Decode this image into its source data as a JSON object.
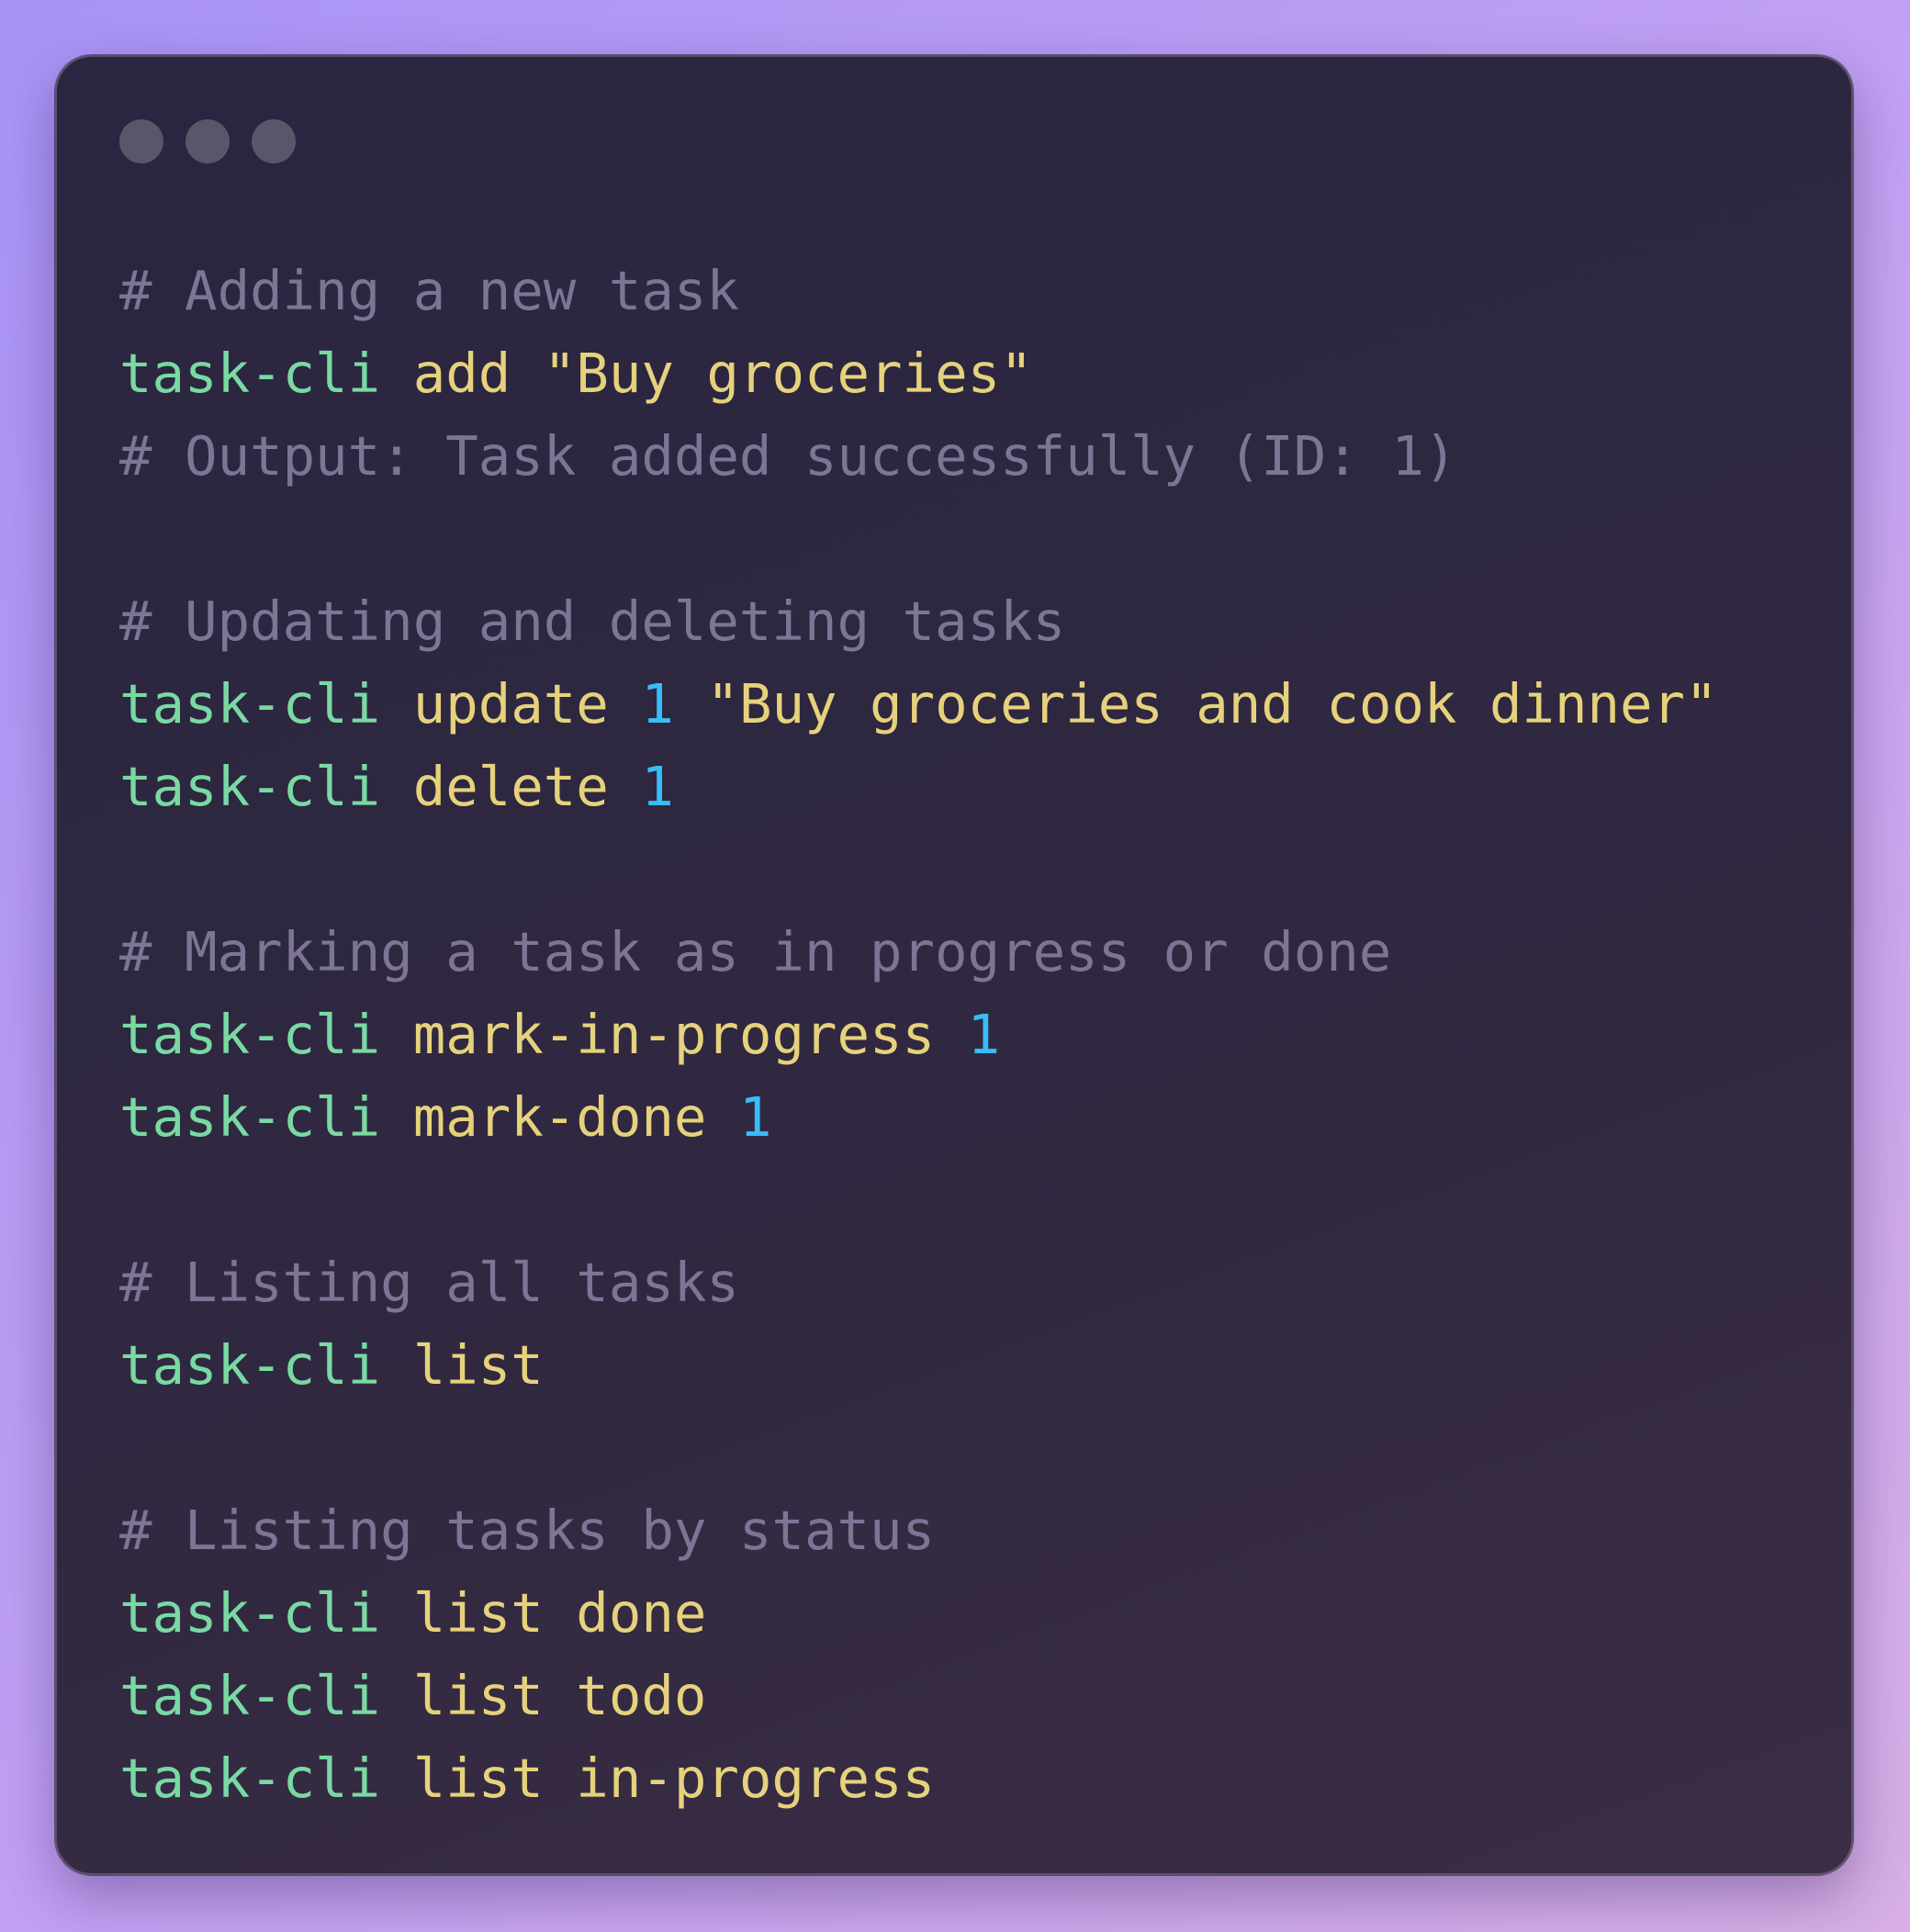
{
  "window": {
    "controls": [
      "close",
      "minimize",
      "maximize"
    ]
  },
  "colors": {
    "comment": "#7d7596",
    "command": "#79d9a3",
    "subcommand": "#e6d27c",
    "number": "#38bdf8",
    "string": "#e6d27c"
  },
  "code": {
    "lines": [
      {
        "kind": "comment",
        "text": "# Adding a new task"
      },
      {
        "kind": "code",
        "cmd": "task-cli",
        "sub": "add",
        "str": "\"Buy groceries\""
      },
      {
        "kind": "comment",
        "text": "# Output: Task added successfully (ID: 1)"
      },
      {
        "kind": "blank"
      },
      {
        "kind": "comment",
        "text": "# Updating and deleting tasks"
      },
      {
        "kind": "code",
        "cmd": "task-cli",
        "sub": "update",
        "num": "1",
        "str": "\"Buy groceries and cook dinner\""
      },
      {
        "kind": "code",
        "cmd": "task-cli",
        "sub": "delete",
        "num": "1"
      },
      {
        "kind": "blank"
      },
      {
        "kind": "comment",
        "text": "# Marking a task as in progress or done"
      },
      {
        "kind": "code",
        "cmd": "task-cli",
        "sub": "mark-in-progress",
        "num": "1"
      },
      {
        "kind": "code",
        "cmd": "task-cli",
        "sub": "mark-done",
        "num": "1"
      },
      {
        "kind": "blank"
      },
      {
        "kind": "comment",
        "text": "# Listing all tasks"
      },
      {
        "kind": "code",
        "cmd": "task-cli",
        "sub": "list"
      },
      {
        "kind": "blank"
      },
      {
        "kind": "comment",
        "text": "# Listing tasks by status"
      },
      {
        "kind": "code",
        "cmd": "task-cli",
        "sub": "list done"
      },
      {
        "kind": "code",
        "cmd": "task-cli",
        "sub": "list todo"
      },
      {
        "kind": "code",
        "cmd": "task-cli",
        "sub": "list in-progress"
      }
    ]
  }
}
